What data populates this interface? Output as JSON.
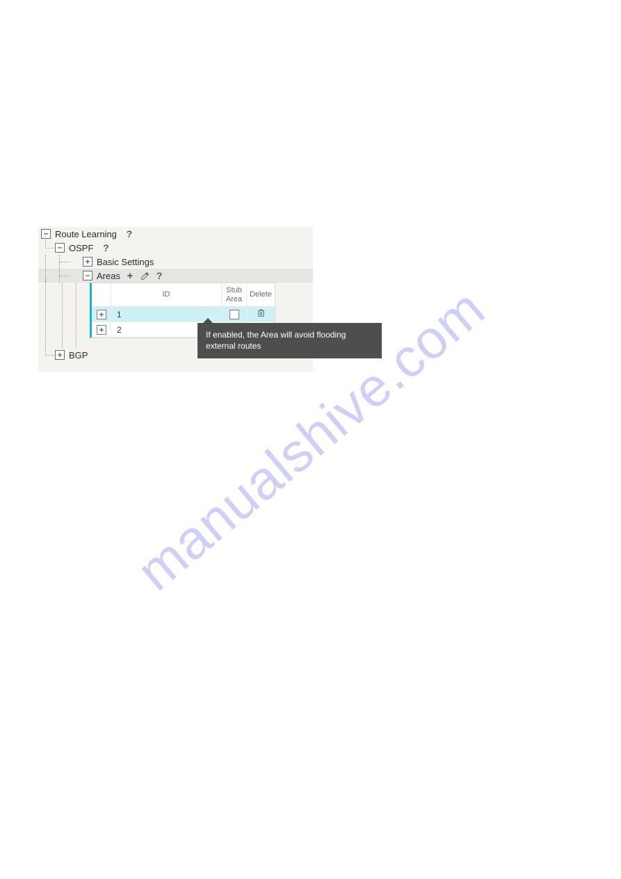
{
  "watermark": "manualshive.com",
  "tree": {
    "route_learning": "Route Learning",
    "ospf": "OSPF",
    "basic_settings": "Basic Settings",
    "areas": "Areas",
    "bgp": "BGP"
  },
  "table": {
    "headers": {
      "id": "ID",
      "stub": "Stub\nArea",
      "delete": "Delete"
    },
    "rows": [
      {
        "id": "1",
        "stub_checked": false,
        "selected": true
      },
      {
        "id": "2",
        "stub_checked": false,
        "selected": false
      }
    ]
  },
  "tooltip": "If enabled, the Area will avoid flooding external routes"
}
